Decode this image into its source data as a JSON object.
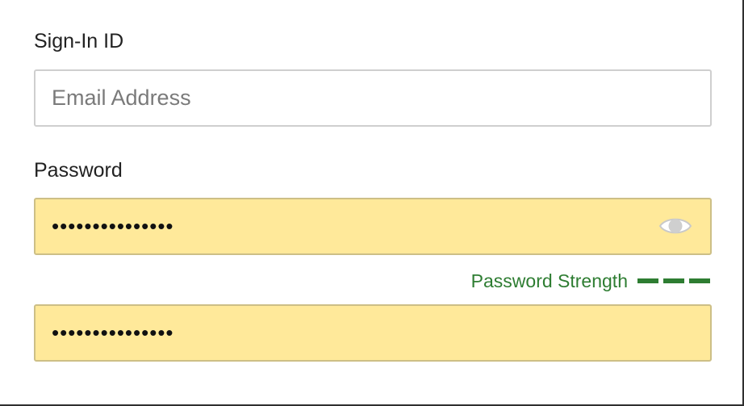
{
  "signin": {
    "label": "Sign-In ID",
    "placeholder": "Email Address",
    "value": ""
  },
  "password": {
    "label": "Password",
    "value": "•••••••••••••••",
    "toggle_icon": "eye-icon",
    "strength": {
      "label": "Password Strength",
      "bars_filled": 3,
      "bars_total": 3,
      "color": "#2e7d32"
    }
  },
  "confirm_password": {
    "value": "•••••••••••••••"
  },
  "colors": {
    "autofill_background": "#ffe99a",
    "text": "#222222",
    "placeholder": "#7a7a7a",
    "strength": "#2e7d32"
  }
}
